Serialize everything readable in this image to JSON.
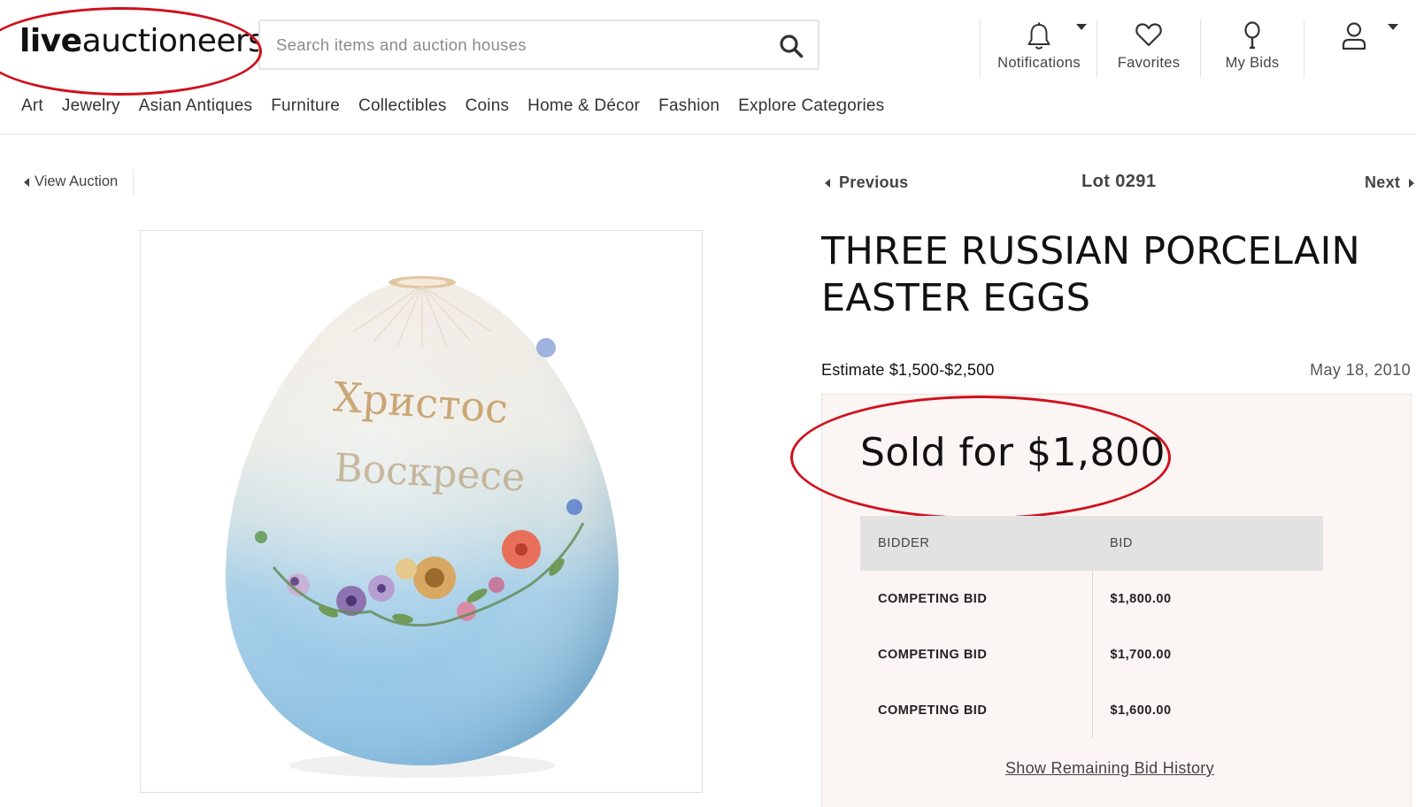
{
  "logo": {
    "bold": "live",
    "rest": "auctioneers"
  },
  "search": {
    "placeholder": "Search items and auction houses",
    "icon": "search-icon"
  },
  "header_nav": [
    {
      "label": "Notifications",
      "icon": "bell-icon"
    },
    {
      "label": "Favorites",
      "icon": "heart-icon"
    },
    {
      "label": "My Bids",
      "icon": "paddle-icon"
    },
    {
      "label": "",
      "icon": "user-icon"
    }
  ],
  "categories": [
    "Art",
    "Jewelry",
    "Asian Antiques",
    "Furniture",
    "Collectibles",
    "Coins",
    "Home & Décor",
    "Fashion",
    "Explore Categories"
  ],
  "subnav": {
    "back": "View Auction",
    "previous": "Previous",
    "lot": "Lot 0291",
    "next": "Next"
  },
  "item": {
    "title": "THREE RUSSIAN PORCELAIN EASTER EGGS",
    "estimate": "Estimate $1,500-$2,500",
    "date": "May 18, 2010",
    "sold": "Sold for $1,800",
    "image_inscription": [
      "Христос",
      "Воскресе"
    ]
  },
  "bid_history": {
    "headers": [
      "BIDDER",
      "BID"
    ],
    "rows": [
      {
        "bidder": "COMPETING BID",
        "bid": "$1,800.00"
      },
      {
        "bidder": "COMPETING BID",
        "bid": "$1,700.00"
      },
      {
        "bidder": "COMPETING BID",
        "bid": "$1,600.00"
      }
    ],
    "show_more": "Show Remaining Bid History"
  },
  "colors": {
    "annotation_red": "#d0101c",
    "panel_bg": "#fbf5f3",
    "table_header_bg": "#e2e2e2",
    "egg_blue": "#8cc3e6"
  }
}
